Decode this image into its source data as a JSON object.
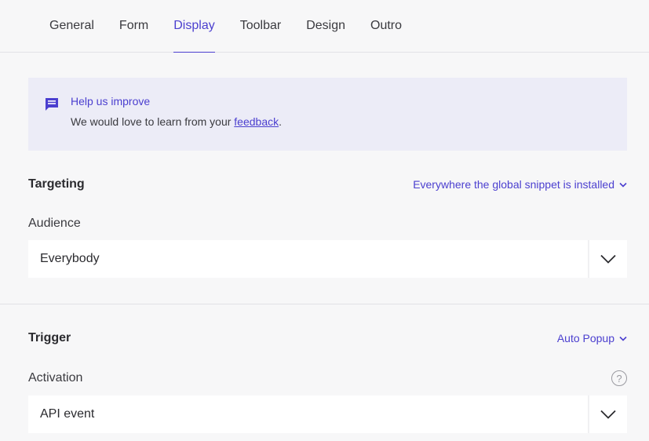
{
  "tabs": [
    {
      "label": "General"
    },
    {
      "label": "Form"
    },
    {
      "label": "Display"
    },
    {
      "label": "Toolbar"
    },
    {
      "label": "Design"
    },
    {
      "label": "Outro"
    }
  ],
  "active_tab": "Display",
  "banner": {
    "icon": "message-icon",
    "title": "Help us improve",
    "text_before": "We would love to learn from your ",
    "link": "feedback",
    "text_after": "."
  },
  "targeting": {
    "title": "Targeting",
    "scope_link": "Everywhere the global snippet is installed",
    "audience_label": "Audience",
    "audience_value": "Everybody"
  },
  "trigger": {
    "title": "Trigger",
    "type_link": "Auto Popup",
    "activation_label": "Activation",
    "activation_value": "API event",
    "help_icon": "?"
  },
  "colors": {
    "accent": "#4b3fcf",
    "background": "#f7f7f8",
    "banner_bg": "#ececf7"
  }
}
